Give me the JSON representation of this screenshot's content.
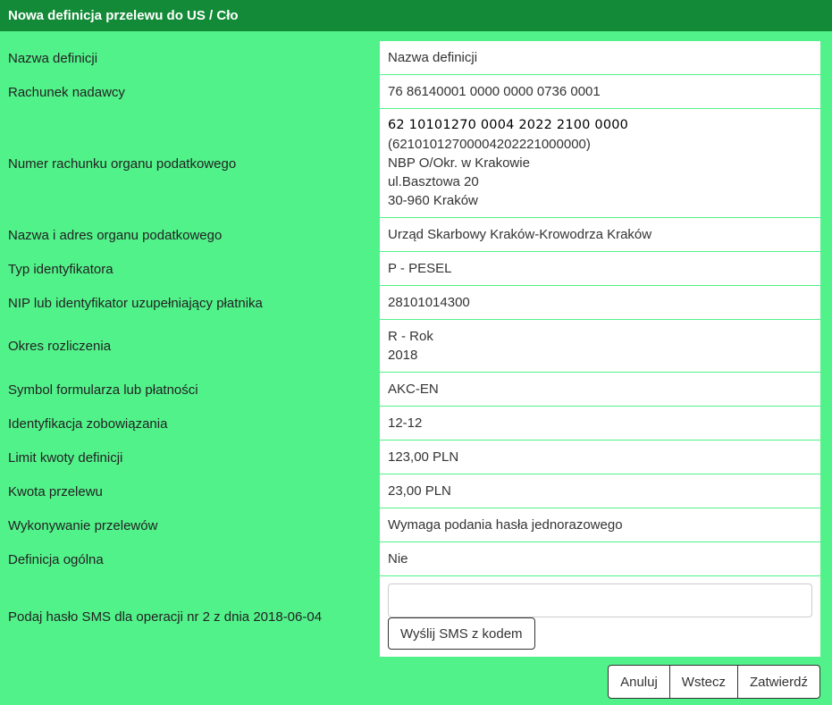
{
  "title": "Nowa definicja przelewu do US / Cło",
  "fields": [
    {
      "label": "Nazwa definicji",
      "lines": [
        "Nazwa definicji"
      ]
    },
    {
      "label": "Rachunek nadawcy",
      "lines": [
        "76 86140001 0000 0000 0736 0001"
      ]
    },
    {
      "label": "Numer rachunku organu podatkowego",
      "account": "62 10101270 0004 2022 2100 0000",
      "lines": [
        "(62101012700004202221000000)",
        "NBP O/Okr. w Krakowie",
        "ul.Basztowa 20",
        "30-960 Kraków"
      ]
    },
    {
      "label": "Nazwa i adres organu podatkowego",
      "lines": [
        "Urząd Skarbowy Kraków-Krowodrza Kraków"
      ]
    },
    {
      "label": "Typ identyfikatora",
      "lines": [
        "P - PESEL"
      ]
    },
    {
      "label": "NIP lub identyfikator uzupełniający płatnika",
      "lines": [
        "28101014300"
      ]
    },
    {
      "label": "Okres rozliczenia",
      "lines": [
        "R - Rok",
        "2018"
      ]
    },
    {
      "label": "Symbol formularza lub płatności",
      "lines": [
        "AKC-EN"
      ]
    },
    {
      "label": "Identyfikacja zobowiązania",
      "lines": [
        "12-12"
      ]
    },
    {
      "label": "Limit kwoty definicji",
      "lines": [
        "123,00 PLN"
      ]
    },
    {
      "label": "Kwota przelewu",
      "lines": [
        "23,00 PLN"
      ]
    },
    {
      "label": "Wykonywanie przelewów",
      "lines": [
        "Wymaga podania hasła jednorazowego"
      ]
    },
    {
      "label": "Definicja ogólna",
      "lines": [
        "Nie"
      ]
    }
  ],
  "sms": {
    "label": "Podaj hasło SMS dla operacji nr 2 z dnia 2018-06-04",
    "input_value": "",
    "send_button": "Wyślij SMS z kodem"
  },
  "buttons": {
    "cancel": "Anuluj",
    "back": "Wstecz",
    "confirm": "Zatwierdź"
  },
  "colors": {
    "titlebar": "#128a37",
    "background": "#52f28a"
  }
}
